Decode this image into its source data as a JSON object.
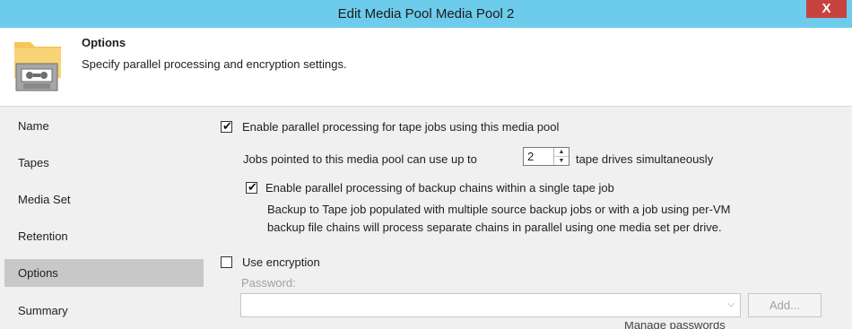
{
  "window": {
    "title": "Edit Media Pool Media Pool 2",
    "close_label": "X"
  },
  "header": {
    "title": "Options",
    "subtitle": "Specify parallel processing and encryption settings."
  },
  "sidebar": {
    "items": [
      {
        "label": "Name",
        "active": false
      },
      {
        "label": "Tapes",
        "active": false
      },
      {
        "label": "Media Set",
        "active": false
      },
      {
        "label": "Retention",
        "active": false
      },
      {
        "label": "Options",
        "active": true
      },
      {
        "label": "Summary",
        "active": false
      }
    ]
  },
  "options": {
    "parallel": {
      "label": "Enable parallel processing for tape jobs using this media pool",
      "checked": true
    },
    "drives": {
      "prefix": "Jobs pointed to this media pool can use up to",
      "value": "2",
      "suffix": "tape drives simultaneously"
    },
    "chains": {
      "label": "Enable parallel processing of backup chains within a single tape job",
      "checked": true,
      "description_line1": "Backup to Tape job populated with multiple source backup jobs or with a job using per-VM",
      "description_line2": "backup file chains will process separate chains in parallel using one media set per drive."
    },
    "encryption": {
      "label": "Use encryption",
      "checked": false
    },
    "password": {
      "label": "Password:",
      "value": "",
      "add_label": "Add...",
      "manage_link": "Manage passwords"
    }
  },
  "colors": {
    "titlebar": "#6dcbeb",
    "close": "#c7433f",
    "panel": "#f0f0f0",
    "active_nav": "#c8c8c8"
  }
}
